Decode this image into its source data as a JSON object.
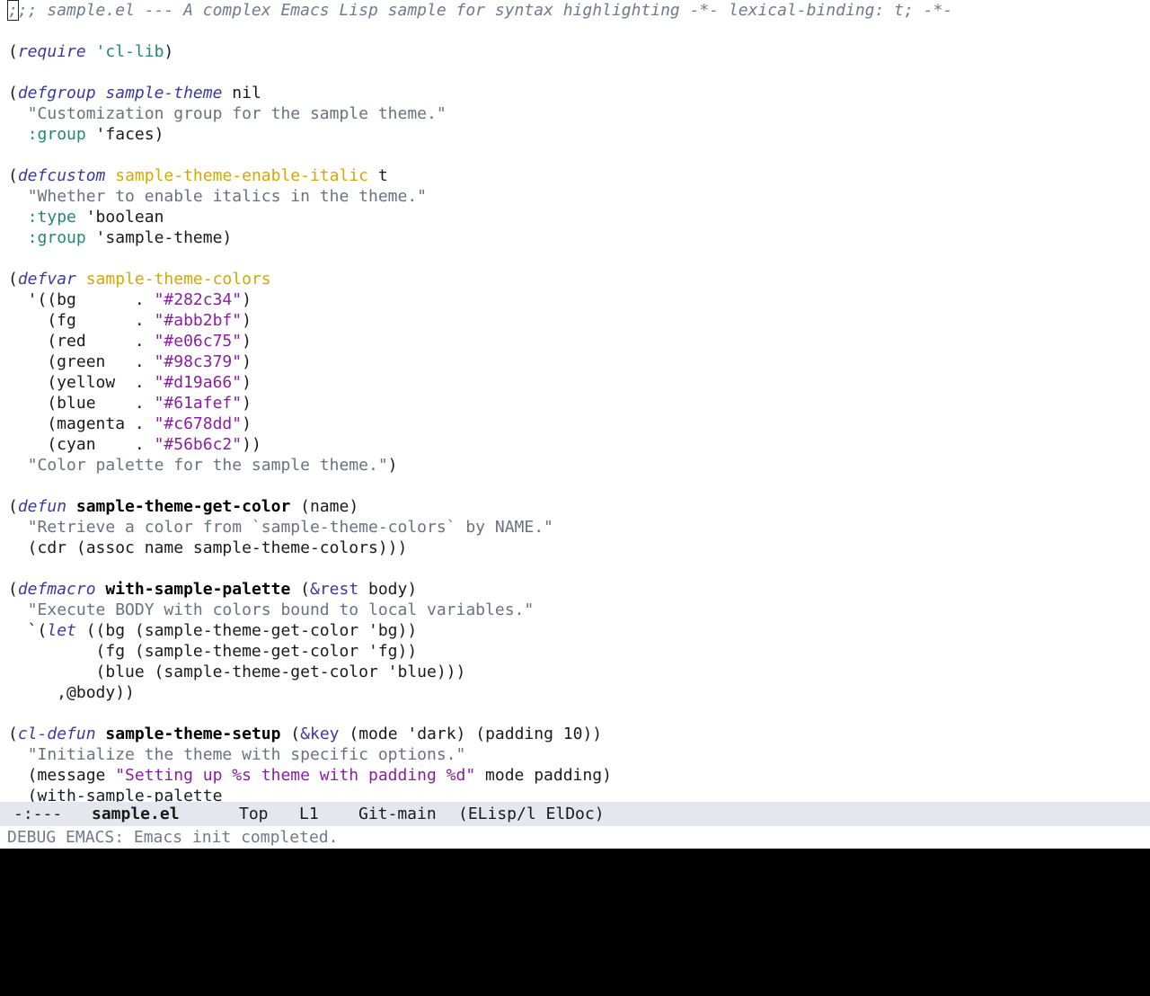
{
  "buffer": {
    "lines": [
      [
        [
          ";",
          "comment",
          "cursor"
        ],
        [
          ";; sample.el --- A complex Emacs Lisp sample for syntax highlighting -*- lexical-binding: t; -*-",
          "comment"
        ]
      ],
      [],
      [
        [
          "(",
          "plain"
        ],
        [
          "require",
          "kw"
        ],
        [
          " ",
          "plain"
        ],
        [
          "'cl-lib",
          "sym"
        ],
        [
          ")",
          "plain"
        ]
      ],
      [],
      [
        [
          "(",
          "plain"
        ],
        [
          "defgroup",
          "kw"
        ],
        [
          " ",
          "plain"
        ],
        [
          "sample-theme",
          "kw"
        ],
        [
          " nil",
          "plain"
        ]
      ],
      [
        [
          "  ",
          "plain"
        ],
        [
          "\"Customization group for the sample theme.\"",
          "str"
        ]
      ],
      [
        [
          "  ",
          "plain"
        ],
        [
          ":group",
          "sym"
        ],
        [
          " 'faces)",
          "plain"
        ]
      ],
      [],
      [
        [
          "(",
          "plain"
        ],
        [
          "defcustom",
          "kw"
        ],
        [
          " ",
          "plain"
        ],
        [
          "sample-theme-enable-italic",
          "var"
        ],
        [
          " t",
          "plain"
        ]
      ],
      [
        [
          "  ",
          "plain"
        ],
        [
          "\"Whether to enable italics in the theme.\"",
          "str"
        ]
      ],
      [
        [
          "  ",
          "plain"
        ],
        [
          ":type",
          "sym"
        ],
        [
          " 'boolean",
          "plain"
        ]
      ],
      [
        [
          "  ",
          "plain"
        ],
        [
          ":group",
          "sym"
        ],
        [
          " 'sample-theme)",
          "plain"
        ]
      ],
      [],
      [
        [
          "(",
          "plain"
        ],
        [
          "defvar",
          "kw"
        ],
        [
          " ",
          "plain"
        ],
        [
          "sample-theme-colors",
          "var"
        ]
      ],
      [
        [
          "  '((bg      . ",
          "plain"
        ],
        [
          "\"#282c34\"",
          "hex"
        ],
        [
          ")",
          "plain"
        ]
      ],
      [
        [
          "    (fg      . ",
          "plain"
        ],
        [
          "\"#abb2bf\"",
          "hex"
        ],
        [
          ")",
          "plain"
        ]
      ],
      [
        [
          "    (red     . ",
          "plain"
        ],
        [
          "\"#e06c75\"",
          "hex"
        ],
        [
          ")",
          "plain"
        ]
      ],
      [
        [
          "    (green   . ",
          "plain"
        ],
        [
          "\"#98c379\"",
          "hex"
        ],
        [
          ")",
          "plain"
        ]
      ],
      [
        [
          "    (yellow  . ",
          "plain"
        ],
        [
          "\"#d19a66\"",
          "hex"
        ],
        [
          ")",
          "plain"
        ]
      ],
      [
        [
          "    (blue    . ",
          "plain"
        ],
        [
          "\"#61afef\"",
          "hex"
        ],
        [
          ")",
          "plain"
        ]
      ],
      [
        [
          "    (magenta . ",
          "plain"
        ],
        [
          "\"#c678dd\"",
          "hex"
        ],
        [
          ")",
          "plain"
        ]
      ],
      [
        [
          "    (cyan    . ",
          "plain"
        ],
        [
          "\"#56b6c2\"",
          "hex"
        ],
        [
          "))",
          "plain"
        ]
      ],
      [
        [
          "  ",
          "plain"
        ],
        [
          "\"Color palette for the sample theme.\"",
          "str"
        ],
        [
          ")",
          "plain"
        ]
      ],
      [],
      [
        [
          "(",
          "plain"
        ],
        [
          "defun",
          "kw"
        ],
        [
          " ",
          "plain"
        ],
        [
          "sample-theme-get-color",
          "fn"
        ],
        [
          " (name)",
          "plain"
        ]
      ],
      [
        [
          "  ",
          "plain"
        ],
        [
          "\"Retrieve a color from `sample-theme-colors` by NAME.\"",
          "str"
        ]
      ],
      [
        [
          "  (cdr (assoc name sample-theme-colors)))",
          "plain"
        ]
      ],
      [],
      [
        [
          "(",
          "plain"
        ],
        [
          "defmacro",
          "kw"
        ],
        [
          " ",
          "plain"
        ],
        [
          "with-sample-palette",
          "fn"
        ],
        [
          " (",
          "plain"
        ],
        [
          "&rest",
          "kw-up"
        ],
        [
          " body)",
          "plain"
        ]
      ],
      [
        [
          "  ",
          "plain"
        ],
        [
          "\"Execute BODY with colors bound to local variables.\"",
          "str"
        ]
      ],
      [
        [
          "  `(",
          "plain"
        ],
        [
          "let",
          "kw"
        ],
        [
          " ((bg (sample-theme-get-color 'bg))",
          "plain"
        ]
      ],
      [
        [
          "         (fg (sample-theme-get-color 'fg))",
          "plain"
        ]
      ],
      [
        [
          "         (blue (sample-theme-get-color 'blue)))",
          "plain"
        ]
      ],
      [
        [
          "     ,@body))",
          "plain"
        ]
      ],
      [],
      [
        [
          "(",
          "plain"
        ],
        [
          "cl-defun",
          "kw"
        ],
        [
          " ",
          "plain"
        ],
        [
          "sample-theme-setup",
          "fn"
        ],
        [
          " (",
          "plain"
        ],
        [
          "&key",
          "kw-up"
        ],
        [
          " (mode 'dark) (padding 10))",
          "plain"
        ]
      ],
      [
        [
          "  ",
          "plain"
        ],
        [
          "\"Initialize the theme with specific options.\"",
          "str"
        ]
      ],
      [
        [
          "  (message ",
          "plain"
        ],
        [
          "\"Setting up %s theme with padding %d\"",
          "hex"
        ],
        [
          " mode padding)",
          "plain"
        ]
      ],
      [
        [
          "  (with-sample-palette",
          "plain"
        ]
      ]
    ]
  },
  "modeline": {
    "status": "-:---",
    "buffer_name": "sample.el",
    "position": "Top",
    "line": "L1",
    "vc": "Git-main",
    "modes": "(ELisp/l ElDoc)"
  },
  "minibuffer": {
    "message": "DEBUG EMACS: Emacs init completed."
  },
  "colors": {
    "background": "#ffffff",
    "modeline_bg": "#e6e6ee",
    "comment": "#707a8c",
    "keyword": "#3a3aa0",
    "string": "#6a7180",
    "string_hex": "#8a1ea0",
    "keyword_symbol": "#22867a",
    "variable": "#d4a800"
  }
}
